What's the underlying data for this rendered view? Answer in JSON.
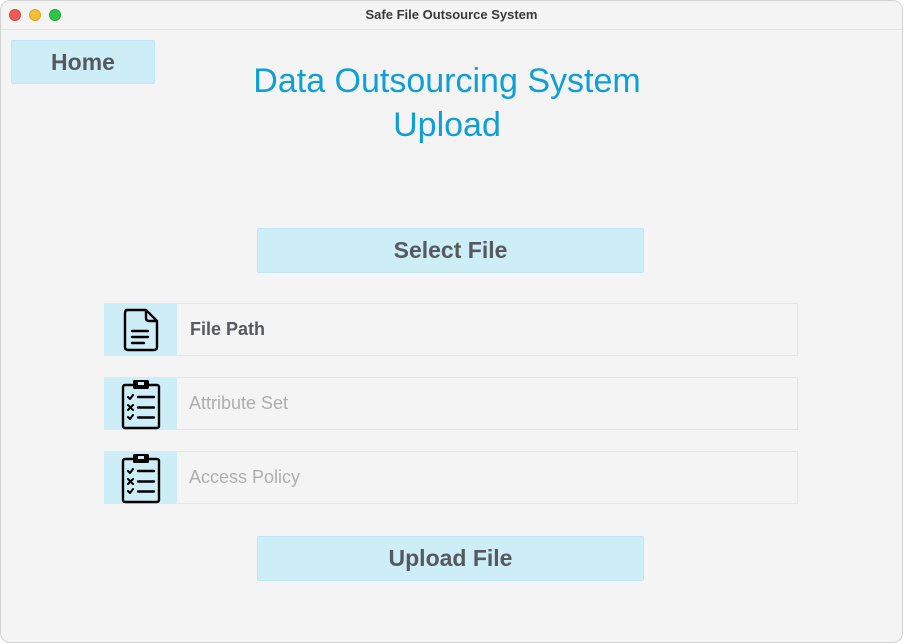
{
  "window": {
    "title": "Safe File Outsource System"
  },
  "nav": {
    "home_label": "Home"
  },
  "heading": {
    "line1": "Data Outsourcing System",
    "line2": "Upload"
  },
  "actions": {
    "select_file_label": "Select File",
    "upload_file_label": "Upload File"
  },
  "fields": {
    "file_path": {
      "value": "File Path",
      "icon": "document-icon"
    },
    "attribute_set": {
      "placeholder": "Attribute Set",
      "icon": "clipboard-checklist-icon"
    },
    "access_policy": {
      "placeholder": "Access Policy",
      "icon": "clipboard-checklist-icon"
    }
  },
  "colors": {
    "accent": "#0f9fd8",
    "button_bg": "#cdedf7",
    "button_text": "#545a5e",
    "window_bg": "#f4f4f4"
  }
}
